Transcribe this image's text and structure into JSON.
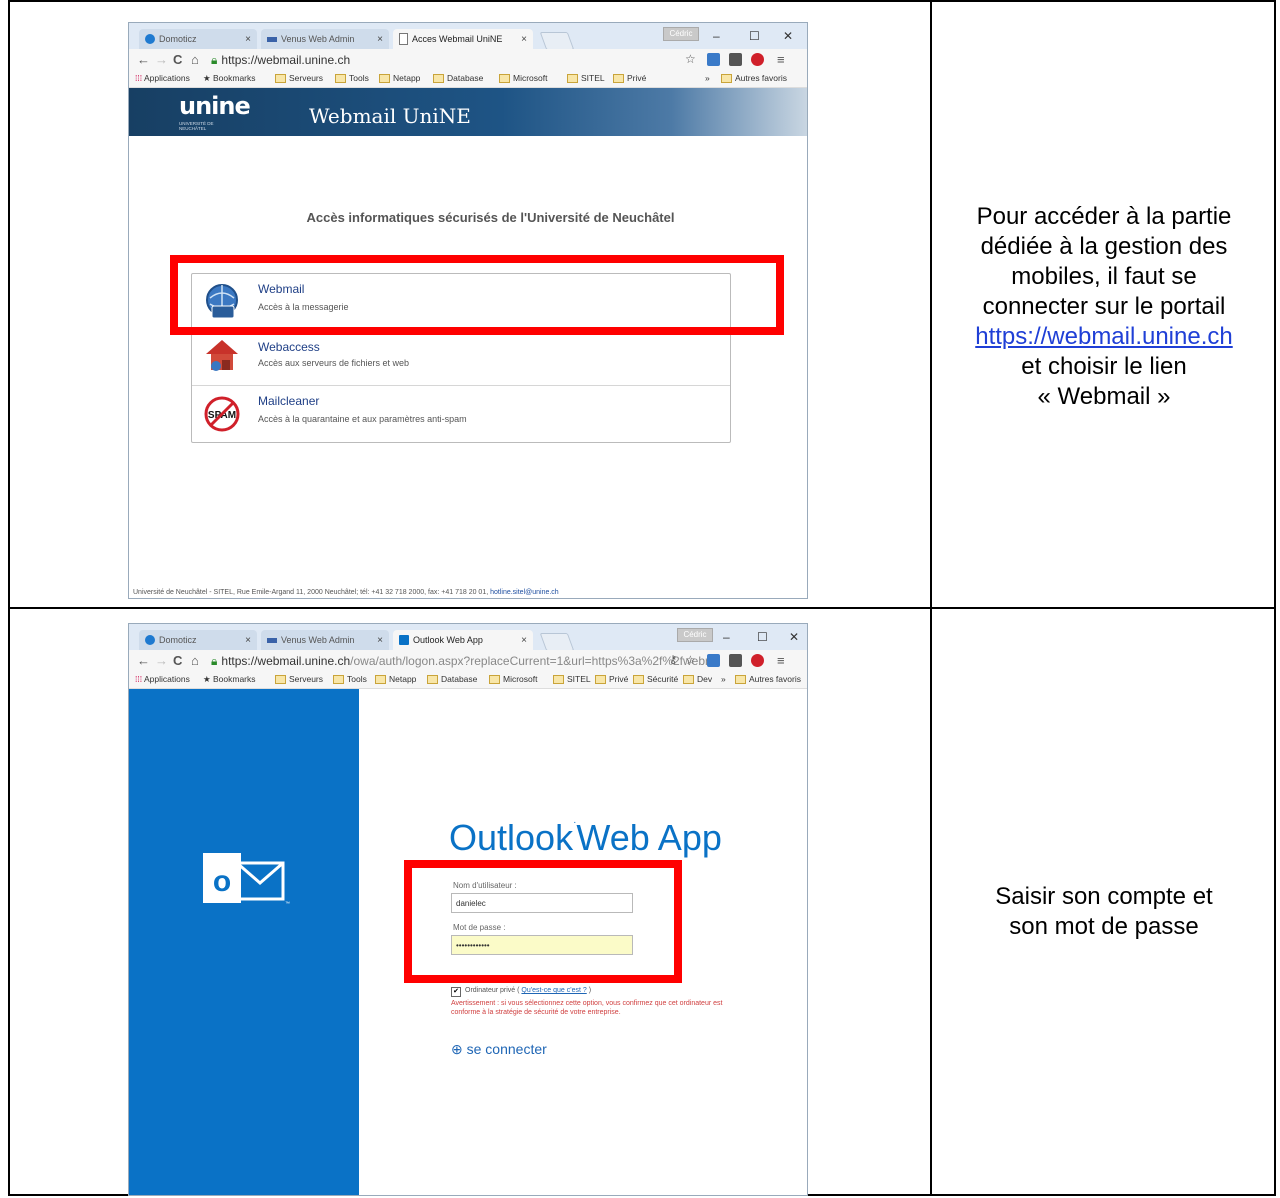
{
  "rows": [
    {
      "caption": {
        "line1": "Pour accéder à la partie",
        "line2": "dédiée à la gestion des",
        "line3": "mobiles, il faut se",
        "line4": "connecter sur le portail",
        "link": "https://webmail.unine.ch",
        "line5": "et choisir le lien",
        "line6": "« Webmail »"
      },
      "browser": {
        "tabs": [
          "Domoticz",
          "Venus Web Admin",
          "Acces Webmail UniNE"
        ],
        "user_badge": "Cédric",
        "url": "https://webmail.unine.ch",
        "bookmarks": [
          "Applications",
          "Bookmarks",
          "Serveurs",
          "Tools",
          "Netapp",
          "Database",
          "Microsoft",
          "SITEL",
          "Privé",
          "Autres favoris"
        ],
        "header_logo": "unine",
        "header_logo_sub": "UNIVERSITÉ DE NEUCHÂTEL",
        "header_title": "Webmail UniNE",
        "heading": "Accès informatiques sécurisés de l'Université de Neuchâtel",
        "links": [
          {
            "name": "Webmail",
            "desc": "Accès à la messagerie"
          },
          {
            "name": "Webaccess",
            "desc": "Accès aux serveurs de fichiers et web"
          },
          {
            "name": "Mailcleaner",
            "desc": "Accès à la quarantaine et aux paramètres anti-spam"
          }
        ],
        "footer": "Université de Neuchâtel - SITEL, Rue Emile-Argand 11, 2000 Neuchâtel; tél: +41 32 718 2000, fax: +41 718 20 01,",
        "footer_email": "hotline.sitel@unine.ch"
      }
    },
    {
      "caption": {
        "line1": "Saisir son compte et",
        "line2": "son mot de passe"
      },
      "browser": {
        "tabs": [
          "Domoticz",
          "Venus Web Admin",
          "Outlook Web App"
        ],
        "user_badge": "Cédric",
        "url_main": "https://webmail.unine.ch",
        "url_rest": "/owa/auth/logon.aspx?replaceCurrent=1&url=https%3a%2f%2fwebr",
        "bookmarks": [
          "Applications",
          "Bookmarks",
          "Serveurs",
          "Tools",
          "Netapp",
          "Database",
          "Microsoft",
          "SITEL",
          "Privé",
          "Sécurité",
          "Dev",
          "Autres favoris"
        ],
        "owa_title_1": "Outlook",
        "owa_title_2": "Web App",
        "username_label": "Nom d'utilisateur :",
        "username_value": "danielec",
        "password_label": "Mot de passe :",
        "password_value": "••••••••••••",
        "private_label": "Ordinateur privé (",
        "private_link": "Qu'est-ce que c'est ?",
        "private_label_end": ")",
        "warning": "Avertissement : si vous sélectionnez cette option, vous confirmez que cet ordinateur est conforme à la stratégie de sécurité de votre entreprise.",
        "connect_label": "se connecter",
        "logo_letter": "o"
      }
    }
  ],
  "colors": {
    "red_highlight": "#ff0000",
    "owa_blue": "#0a72c6",
    "unine_blue": "#1e5485"
  }
}
